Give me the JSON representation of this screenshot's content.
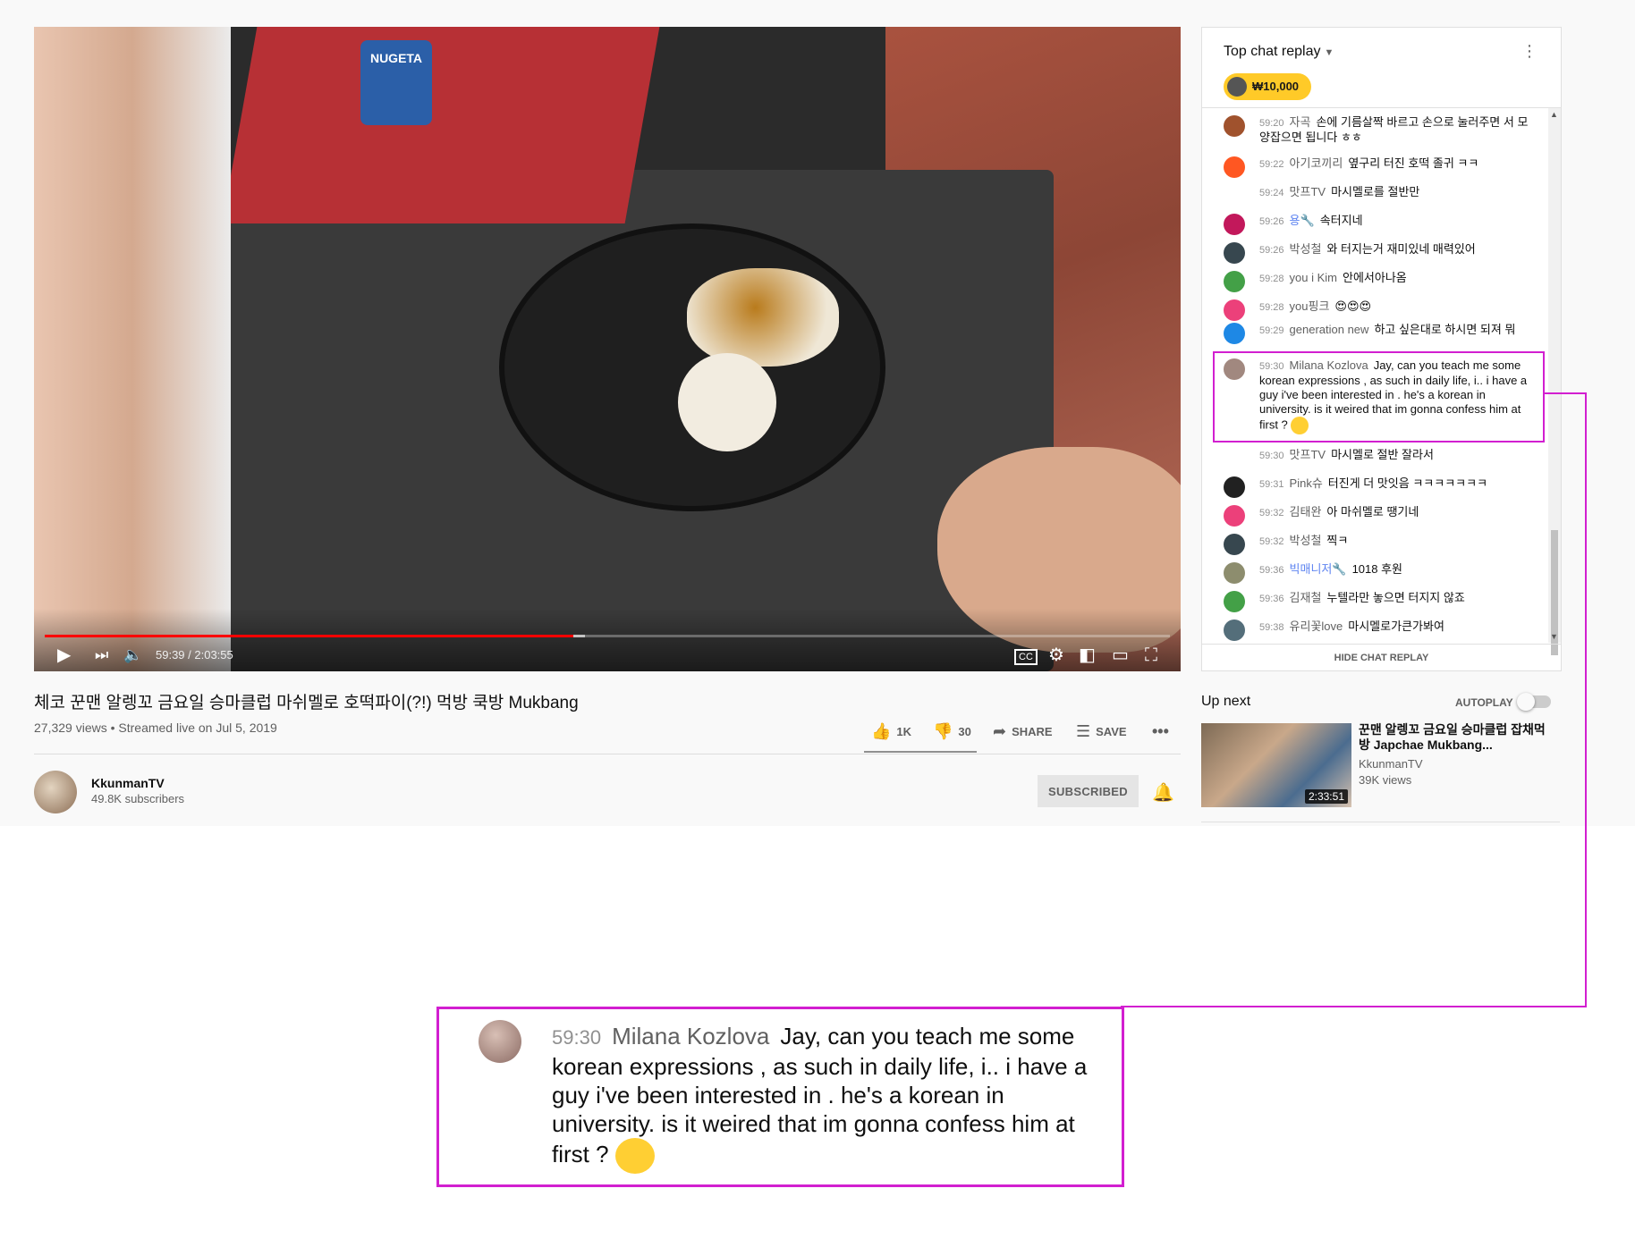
{
  "video": {
    "time_display": "59:39 / 2:03:55",
    "progress": 0.47,
    "buffered": 0.48,
    "title": "체코 꾼맨 알렝꼬 금요일 승마클럽 마쉬멜로 호떡파이(?!) 먹방 쿡방 Mukbang",
    "meta": "27,329 views • Streamed live on Jul 5, 2019",
    "scene_labels": {
      "jar": "NUGETA"
    }
  },
  "actions": {
    "like_count": "1K",
    "dislike_count": "30",
    "share_label": "SHARE",
    "save_label": "SAVE"
  },
  "channel": {
    "name": "KkunmanTV",
    "subscribers": "49.8K subscribers",
    "subscribe_label": "SUBSCRIBED"
  },
  "chat": {
    "header": "Top chat replay",
    "ticker_amount": "₩10,000",
    "hide_label": "HIDE CHAT REPLAY",
    "messages": [
      {
        "time": "59:20",
        "author": "자곡",
        "text": "손에 기름살짝 바르고 손으로 눌러주면 서 모양잡으면 됩니다 ㅎㅎ",
        "avatar_color": "#a0522d"
      },
      {
        "time": "59:22",
        "author": "아기코끼리",
        "text": "옆구리 터진 호떡 졸귀 ㅋㅋ",
        "avatar_color": "#ff5722"
      },
      {
        "time": "59:24",
        "author": "맛프TV",
        "text": "마시멜로를 절반만",
        "avatar_color": "#ffffff"
      },
      {
        "time": "59:26",
        "author": "용🔧",
        "text": "속터지네",
        "avatar_color": "#c2185b"
      },
      {
        "time": "59:26",
        "author": "박성철",
        "text": "와 터지는거 재미있네 매력있어",
        "avatar_color": "#37474f"
      },
      {
        "time": "59:28",
        "author": "you i Kim",
        "text": "안에서아나옴",
        "avatar_color": "#43a047"
      },
      {
        "time": "59:28",
        "author": "you핑크",
        "text": "😍😍😍",
        "avatar_color": "#ec407a"
      },
      {
        "time": "59:29",
        "author": "generation new",
        "text": "하고 싶은대로 하시면 되져 뭐",
        "avatar_color": "#1e88e5"
      },
      {
        "time": "59:30",
        "author": "Milana Kozlova",
        "text": "Jay, can you teach me some korean expressions , as such in daily life, i.. i have a guy i've been interested in . he's a korean in university. is it weired that im gonna confess him at first ?",
        "avatar_color": "#a1887f"
      },
      {
        "time": "59:30",
        "author": "맛프TV",
        "text": "마시멜로 절반 잘라서",
        "avatar_color": "#ffffff"
      },
      {
        "time": "59:31",
        "author": "Pink슈",
        "text": "터진게 더 맛잇음 ㅋㅋㅋㅋㅋㅋㅋ",
        "avatar_color": "#212121"
      },
      {
        "time": "59:32",
        "author": "김태완",
        "text": "아 마쉬멜로 땡기네",
        "avatar_color": "#ec407a"
      },
      {
        "time": "59:32",
        "author": "박성철",
        "text": "찍ㅋ",
        "avatar_color": "#37474f"
      },
      {
        "time": "59:36",
        "author": "빅매니저🔧",
        "text": "1018 후원",
        "avatar_color": "#8d8d6e"
      },
      {
        "time": "59:36",
        "author": "김재철",
        "text": "누텔라만 놓으면 터지지 않죠",
        "avatar_color": "#43a047"
      },
      {
        "time": "59:38",
        "author": "유리꽃love",
        "text": "마시멜로가큰가봐여",
        "avatar_color": "#546e7a"
      }
    ]
  },
  "upnext": {
    "label": "Up next",
    "autoplay_label": "AUTOPLAY",
    "rec_title": "꾼맨 알렝꼬 금요일 승마클럽 잡채먹방 Japchae Mukbang...",
    "rec_channel": "KkunmanTV",
    "rec_views": "39K views",
    "rec_duration": "2:33:51"
  },
  "zoom": {
    "time": "59:30",
    "author": "Milana Kozlova",
    "text": "Jay, can you teach me some korean expressions , as such in daily life, i.. i have a guy i've been interested in . he's a korean in university. is it weired that im gonna confess him at first ?"
  },
  "colors": {
    "highlight": "#d21fd0",
    "progress": "#ff0000",
    "ticker": "#ffca28",
    "moderator": "#5e84f1"
  },
  "icons": [
    "play-icon",
    "next-icon",
    "volume-icon",
    "captions-icon",
    "settings-icon",
    "miniplayer-icon",
    "theater-icon",
    "fullscreen-icon",
    "like-icon",
    "dislike-icon",
    "share-icon",
    "save-icon",
    "more-icon",
    "bell-icon",
    "chevron-down-icon",
    "menu-icon",
    "emoji-icon"
  ]
}
